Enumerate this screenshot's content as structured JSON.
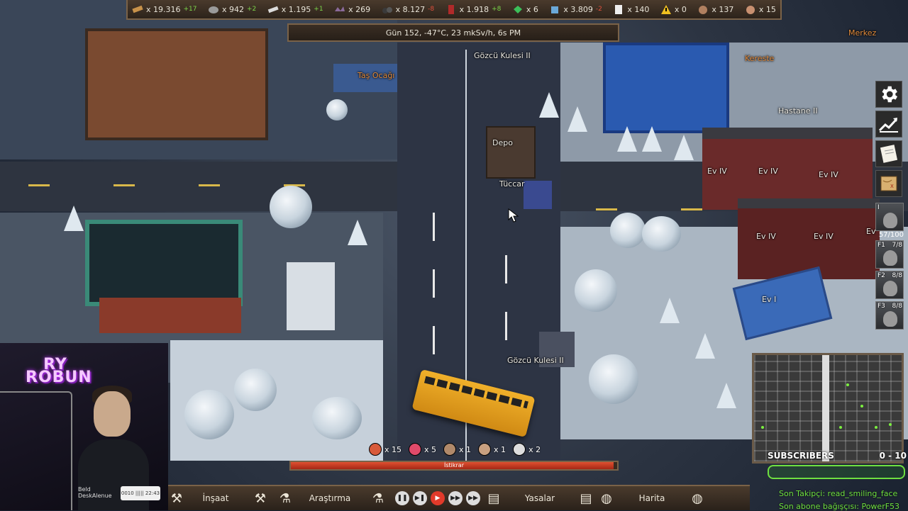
{
  "resources": [
    {
      "id": "wood",
      "value": "x 19.316",
      "delta": "+17",
      "delta_type": "pos",
      "icon": "wood-plank-icon",
      "color": "#c8924a"
    },
    {
      "id": "stone",
      "value": "x 942",
      "delta": "+2",
      "delta_type": "pos",
      "icon": "stone-icon",
      "color": "#9a9a9a"
    },
    {
      "id": "steel",
      "value": "x 1.195",
      "delta": "+1",
      "delta_type": "pos",
      "icon": "steel-bar-icon",
      "color": "#dcdcdc"
    },
    {
      "id": "scrap",
      "value": "x 269",
      "delta": "",
      "delta_type": "pos",
      "icon": "scrap-metal-icon",
      "color": "#8a6a9a"
    },
    {
      "id": "coal",
      "value": "x 8.127",
      "delta": "-8",
      "delta_type": "neg",
      "icon": "coal-icon",
      "color": "#3a3a3a"
    },
    {
      "id": "fuel",
      "value": "x 1.918",
      "delta": "+8",
      "delta_type": "pos",
      "icon": "fuel-canister-icon",
      "color": "#b02a2a"
    },
    {
      "id": "gems",
      "value": "x 6",
      "delta": "",
      "delta_type": "pos",
      "icon": "green-gem-icon",
      "color": "#3cbf5a"
    },
    {
      "id": "food",
      "value": "x 3.809",
      "delta": "-2",
      "delta_type": "neg",
      "icon": "food-icon",
      "color": "#6aa8d8"
    },
    {
      "id": "documents",
      "value": "x 140",
      "delta": "",
      "delta_type": "pos",
      "icon": "document-icon",
      "color": "#eeeeee"
    },
    {
      "id": "alerts",
      "value": "x 0",
      "delta": "",
      "delta_type": "pos",
      "icon": "warning-icon",
      "color": "#f0c020"
    },
    {
      "id": "workers",
      "value": "x 137",
      "delta": "",
      "delta_type": "pos",
      "icon": "worker-face-icon",
      "color": "#b08060"
    },
    {
      "id": "children",
      "value": "x 15",
      "delta": "",
      "delta_type": "pos",
      "icon": "child-face-icon",
      "color": "#c89070"
    }
  ],
  "date_status": "Gün 152, -47°C, 23 mkSv/h, 6s PM",
  "map_labels": [
    {
      "text": "Gözcü Kulesi II",
      "style": "white"
    },
    {
      "text": "Taş Ocağı",
      "style": "orange"
    },
    {
      "text": "Depo",
      "style": "white"
    },
    {
      "text": "Tüccar",
      "style": "white"
    },
    {
      "text": "Gözcü Kulesi II",
      "style": "white"
    },
    {
      "text": "Merkez",
      "style": "orange"
    },
    {
      "text": "Kereste",
      "style": "orange"
    },
    {
      "text": "Hastane II",
      "style": "white"
    },
    {
      "text": "Ev IV",
      "style": "white"
    },
    {
      "text": "Ev IV",
      "style": "white"
    },
    {
      "text": "Ev IV",
      "style": "white"
    },
    {
      "text": "Ev IV",
      "style": "white"
    },
    {
      "text": "Ev IV",
      "style": "white"
    },
    {
      "text": "Ev",
      "style": "white"
    },
    {
      "text": "Ev I",
      "style": "white"
    }
  ],
  "sidebar": {
    "settings_icon": "gear-icon",
    "stats_icon": "chart-icon",
    "notes_icon": "notes-icon",
    "map_icon": "treasure-map-icon"
  },
  "units": [
    {
      "label": "I",
      "count": "57/100"
    },
    {
      "label": "F1",
      "count": "7/8"
    },
    {
      "label": "F2",
      "count": "8/8"
    },
    {
      "label": "F3",
      "count": "8/8"
    }
  ],
  "squad": [
    {
      "value": "x 15",
      "color": "#d85a3a"
    },
    {
      "value": "x 5",
      "color": "#e04a6a"
    },
    {
      "value": "x 1",
      "color": "#b0896a"
    },
    {
      "value": "x 1",
      "color": "#c8a080"
    },
    {
      "value": "x 2",
      "color": "#dddddd"
    }
  ],
  "progress": {
    "label": "İstikrar",
    "fraction": 0.99
  },
  "bottom": {
    "build_label": "İnşaat",
    "research_label": "Araştırma",
    "laws_label": "Yasalar",
    "map_label": "Harita",
    "speeds": [
      "pause",
      "1x",
      "2x",
      "3x",
      "4x"
    ],
    "active_speed": 2
  },
  "stream": {
    "logo": "RY\nROBUN",
    "subs_label": "SUBSCRIBERS",
    "subs_count": "0 - 10",
    "last_follower": "Son Takipçi: read_smiling_face",
    "last_donation": "Son abone bağışçısı: PowerF53",
    "chip_left": "Beld\nDeskAlenue",
    "chip_right": "0010 ||||| 22:43"
  }
}
